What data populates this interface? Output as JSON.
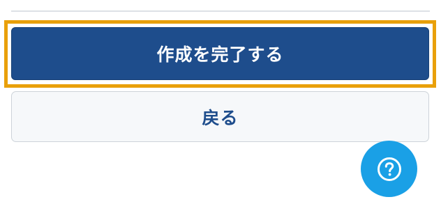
{
  "form_actions": {
    "complete_label": "作成を完了する",
    "back_label": "戻る"
  },
  "help": {
    "icon": "help-circle-icon"
  },
  "colors": {
    "primary": "#1e4d8c",
    "focus_ring": "#e9a00a",
    "secondary_bg": "#f6f8fa",
    "help_fab": "#1aa0e6"
  }
}
